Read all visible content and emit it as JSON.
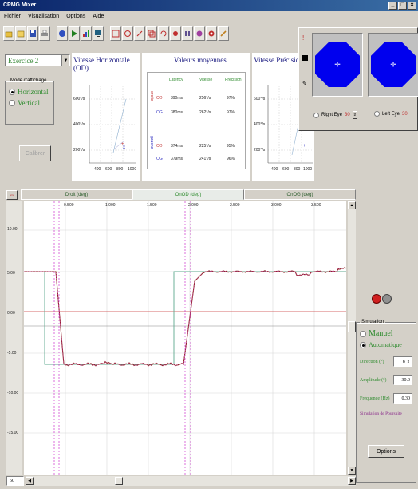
{
  "window": {
    "title": "CPMG Mixer",
    "controls": [
      "_",
      "□",
      "×"
    ]
  },
  "menu": [
    "Fichier",
    "Visualisation",
    "Options",
    "Aide"
  ],
  "toolbar": {
    "group1": [
      "folder-open-icon",
      "folder-icon",
      "save-icon",
      "print-icon"
    ],
    "group2": [
      "eye-icon",
      "play-icon",
      "chart-icon",
      "monitor-icon"
    ],
    "group3": [
      "calibrate-icon",
      "target-icon",
      "edit-icon",
      "copy-icon",
      "rotate-icon",
      "record-icon",
      "pause-icon",
      "eye-test-icon",
      "settings-icon",
      "pen-icon"
    ]
  },
  "left": {
    "exercise": "Exercice 2",
    "mode_group_title": "Mode d'affichage",
    "mode_options": [
      "Horizontal",
      "Vertical"
    ],
    "mode_selected": 0,
    "action_button": "Calibrer"
  },
  "panel_left": {
    "title": "Vitesse Horizontale (OD)",
    "y_ticks": [
      "600°/s",
      "400°/s",
      "200°/s"
    ],
    "x_ticks": [
      "400",
      "600",
      "800",
      "1000"
    ]
  },
  "panel_mid": {
    "title": "Valeurs moyennes",
    "headers": [
      "Latency",
      "Vitesse",
      "Précision"
    ],
    "group_labels": [
      "droite",
      "gauche"
    ],
    "rows": [
      [
        "OD",
        "390ms",
        "256°/s",
        "97%"
      ],
      [
        "OG",
        "380ms",
        "262°/s",
        "97%"
      ],
      [
        "OD",
        "374ms",
        "225°/s",
        "95%"
      ],
      [
        "OG",
        "379ms",
        "241°/s",
        "96%"
      ]
    ]
  },
  "panel_right": {
    "title": "Vitesse Précision",
    "y_ticks": [
      "600°/s",
      "400°/s",
      "200°/s"
    ],
    "x_ticks": [
      "400",
      "600",
      "800",
      "1000"
    ]
  },
  "eye_viewer": {
    "options": [
      "Right Eye",
      "Left Eye"
    ],
    "right_value": "30",
    "left_value": "30"
  },
  "main_tabs": [
    "Droit (deg)",
    "OnOD (deg)",
    "OnOG (deg)"
  ],
  "main_tab_active": 1,
  "main_chart": {
    "top_ticks": [
      "0.000",
      "0.500",
      "1.000",
      "1.500",
      "2.000",
      "2.500",
      "3.000",
      "3.500"
    ],
    "left_ticks": [
      "10.00",
      "5.00",
      "0.00",
      "-5.00",
      "-10.00",
      "-15.00"
    ],
    "traces": {
      "stimulus": {
        "color": "#5fa88f"
      },
      "eye": {
        "color": "#8b1a1a"
      },
      "saccade": {
        "color": "#cc33cc"
      },
      "reference": {
        "color": "#d04040"
      }
    }
  },
  "bottom": {
    "zoom": "50"
  },
  "simulation": {
    "title": "Simulation",
    "options": [
      "Manuel",
      "Automatique"
    ],
    "selected": 1,
    "fields": [
      {
        "label": "Direction (°)",
        "value": "8"
      },
      {
        "label": "Amplitude (°)",
        "value": "30.0"
      },
      {
        "label": "Fréquence (Hz)",
        "value": "0.30"
      }
    ],
    "note": "Simulation de Poursuite",
    "button": "Options"
  }
}
